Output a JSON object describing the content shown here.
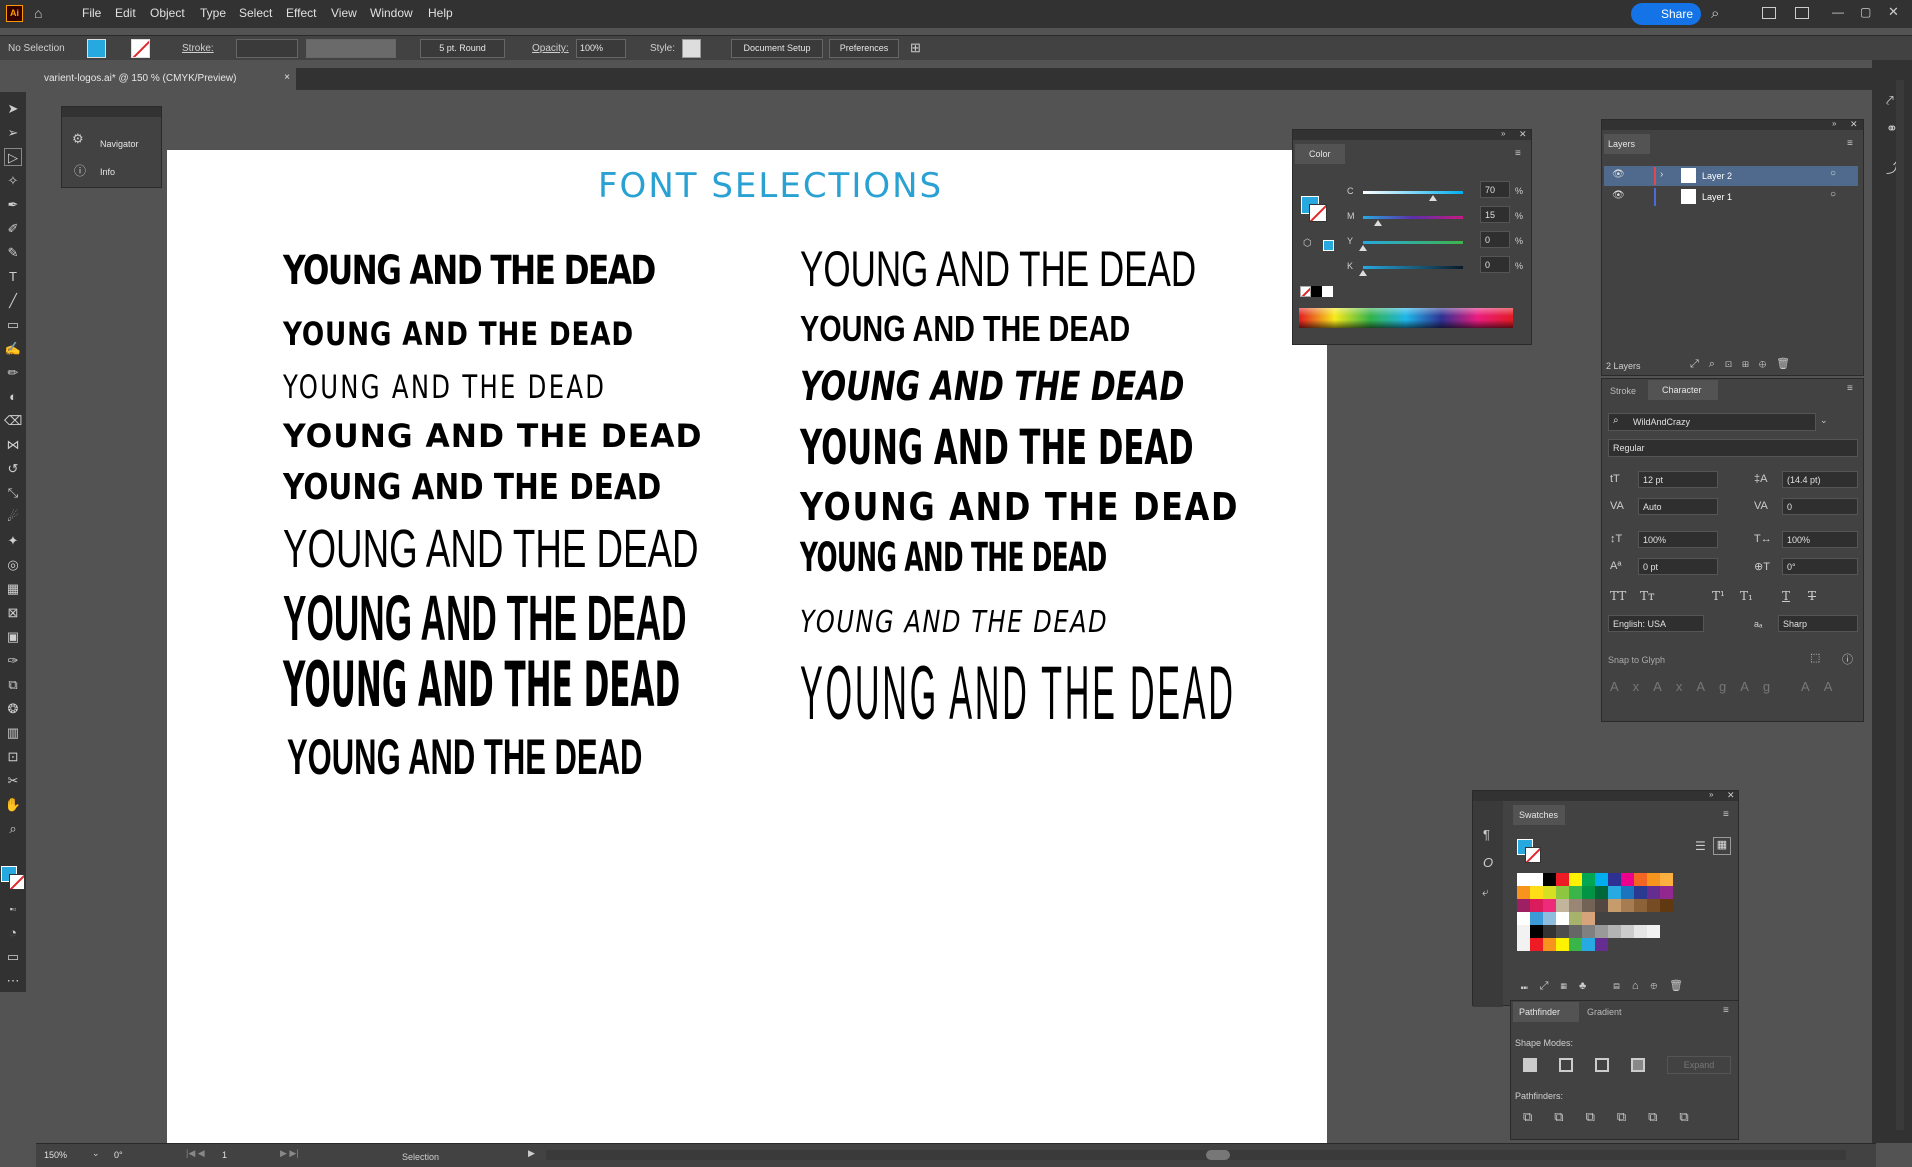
{
  "app": {
    "logo": "Ai"
  },
  "menu": [
    "File",
    "Edit",
    "Object",
    "Type",
    "Select",
    "Effect",
    "View",
    "Window",
    "Help"
  ],
  "share_label": "Share",
  "control": {
    "selection": "No Selection",
    "stroke_label": "Stroke:",
    "brush": "5 pt. Round",
    "opacity_label": "Opacity:",
    "opacity_value": "100%",
    "style_label": "Style:",
    "doc_setup": "Document Setup",
    "preferences": "Preferences"
  },
  "document_tab": "varient-logos.ai* @ 150 % (CMYK/Preview)",
  "mini_panel": {
    "navigator": "Navigator",
    "info": "Info"
  },
  "artboard": {
    "title": "FONT SELECTIONS",
    "text": "YOUNG AND THE DEAD"
  },
  "color_panel": {
    "title": "Color",
    "channels": [
      {
        "label": "C",
        "value": "70",
        "pct": "%",
        "level": 0.7
      },
      {
        "label": "M",
        "value": "15",
        "pct": "%",
        "level": 0.15
      },
      {
        "label": "Y",
        "value": "0",
        "pct": "%",
        "level": 0
      },
      {
        "label": "K",
        "value": "0",
        "pct": "%",
        "level": 0
      }
    ],
    "fill_color": "#27a9e0"
  },
  "layers_panel": {
    "title": "Layers",
    "layers": [
      {
        "name": "Layer 2",
        "color": "#e2484b"
      },
      {
        "name": "Layer 1",
        "color": "#4b6bdb"
      }
    ],
    "count": "2 Layers"
  },
  "character_panel": {
    "tab_stroke": "Stroke",
    "tab_character": "Character",
    "font": "WildAndCrazy",
    "style": "Regular",
    "size": "12 pt",
    "leading": "(14.4 pt)",
    "kerning": "Auto",
    "tracking": "0",
    "vscale": "100%",
    "hscale": "100%",
    "baseline": "0 pt",
    "rotation": "0°",
    "language": "English: USA",
    "aa_label": "aₐ",
    "antialias": "Sharp",
    "snap": "Snap to Glyph"
  },
  "swatches_panel": {
    "title": "Swatches"
  },
  "pathfinder_panel": {
    "tab_pathfinder": "Pathfinder",
    "tab_gradient": "Gradient",
    "shape_modes": "Shape Modes:",
    "expand": "Expand",
    "pathfinders": "Pathfinders:"
  },
  "status": {
    "zoom": "150%",
    "rotate": "0°",
    "artboard_num": "1",
    "tool": "Selection"
  }
}
